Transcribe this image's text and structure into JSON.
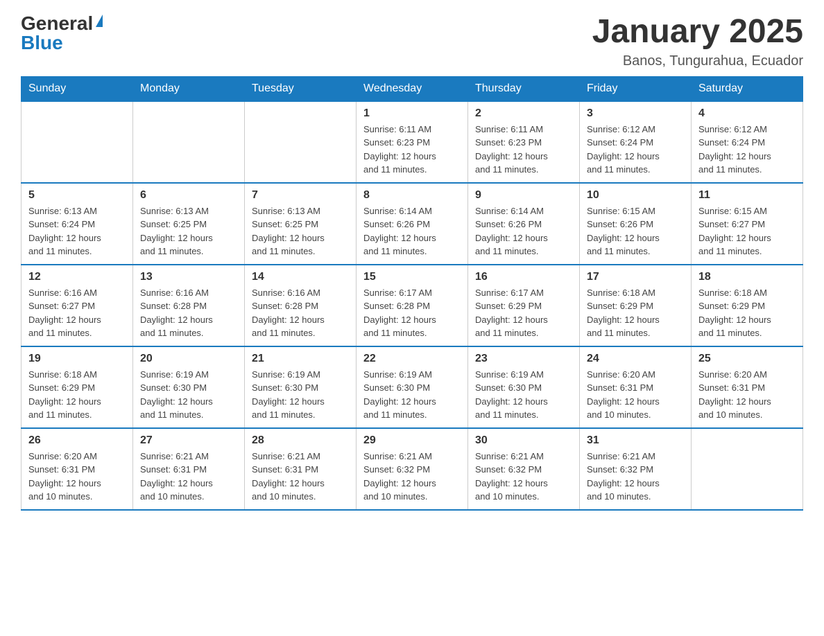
{
  "header": {
    "logo_general": "General",
    "logo_blue": "Blue",
    "month_title": "January 2025",
    "location": "Banos, Tungurahua, Ecuador"
  },
  "days_of_week": [
    "Sunday",
    "Monday",
    "Tuesday",
    "Wednesday",
    "Thursday",
    "Friday",
    "Saturday"
  ],
  "weeks": [
    [
      {
        "day": "",
        "info": ""
      },
      {
        "day": "",
        "info": ""
      },
      {
        "day": "",
        "info": ""
      },
      {
        "day": "1",
        "info": "Sunrise: 6:11 AM\nSunset: 6:23 PM\nDaylight: 12 hours\nand 11 minutes."
      },
      {
        "day": "2",
        "info": "Sunrise: 6:11 AM\nSunset: 6:23 PM\nDaylight: 12 hours\nand 11 minutes."
      },
      {
        "day": "3",
        "info": "Sunrise: 6:12 AM\nSunset: 6:24 PM\nDaylight: 12 hours\nand 11 minutes."
      },
      {
        "day": "4",
        "info": "Sunrise: 6:12 AM\nSunset: 6:24 PM\nDaylight: 12 hours\nand 11 minutes."
      }
    ],
    [
      {
        "day": "5",
        "info": "Sunrise: 6:13 AM\nSunset: 6:24 PM\nDaylight: 12 hours\nand 11 minutes."
      },
      {
        "day": "6",
        "info": "Sunrise: 6:13 AM\nSunset: 6:25 PM\nDaylight: 12 hours\nand 11 minutes."
      },
      {
        "day": "7",
        "info": "Sunrise: 6:13 AM\nSunset: 6:25 PM\nDaylight: 12 hours\nand 11 minutes."
      },
      {
        "day": "8",
        "info": "Sunrise: 6:14 AM\nSunset: 6:26 PM\nDaylight: 12 hours\nand 11 minutes."
      },
      {
        "day": "9",
        "info": "Sunrise: 6:14 AM\nSunset: 6:26 PM\nDaylight: 12 hours\nand 11 minutes."
      },
      {
        "day": "10",
        "info": "Sunrise: 6:15 AM\nSunset: 6:26 PM\nDaylight: 12 hours\nand 11 minutes."
      },
      {
        "day": "11",
        "info": "Sunrise: 6:15 AM\nSunset: 6:27 PM\nDaylight: 12 hours\nand 11 minutes."
      }
    ],
    [
      {
        "day": "12",
        "info": "Sunrise: 6:16 AM\nSunset: 6:27 PM\nDaylight: 12 hours\nand 11 minutes."
      },
      {
        "day": "13",
        "info": "Sunrise: 6:16 AM\nSunset: 6:28 PM\nDaylight: 12 hours\nand 11 minutes."
      },
      {
        "day": "14",
        "info": "Sunrise: 6:16 AM\nSunset: 6:28 PM\nDaylight: 12 hours\nand 11 minutes."
      },
      {
        "day": "15",
        "info": "Sunrise: 6:17 AM\nSunset: 6:28 PM\nDaylight: 12 hours\nand 11 minutes."
      },
      {
        "day": "16",
        "info": "Sunrise: 6:17 AM\nSunset: 6:29 PM\nDaylight: 12 hours\nand 11 minutes."
      },
      {
        "day": "17",
        "info": "Sunrise: 6:18 AM\nSunset: 6:29 PM\nDaylight: 12 hours\nand 11 minutes."
      },
      {
        "day": "18",
        "info": "Sunrise: 6:18 AM\nSunset: 6:29 PM\nDaylight: 12 hours\nand 11 minutes."
      }
    ],
    [
      {
        "day": "19",
        "info": "Sunrise: 6:18 AM\nSunset: 6:29 PM\nDaylight: 12 hours\nand 11 minutes."
      },
      {
        "day": "20",
        "info": "Sunrise: 6:19 AM\nSunset: 6:30 PM\nDaylight: 12 hours\nand 11 minutes."
      },
      {
        "day": "21",
        "info": "Sunrise: 6:19 AM\nSunset: 6:30 PM\nDaylight: 12 hours\nand 11 minutes."
      },
      {
        "day": "22",
        "info": "Sunrise: 6:19 AM\nSunset: 6:30 PM\nDaylight: 12 hours\nand 11 minutes."
      },
      {
        "day": "23",
        "info": "Sunrise: 6:19 AM\nSunset: 6:30 PM\nDaylight: 12 hours\nand 11 minutes."
      },
      {
        "day": "24",
        "info": "Sunrise: 6:20 AM\nSunset: 6:31 PM\nDaylight: 12 hours\nand 10 minutes."
      },
      {
        "day": "25",
        "info": "Sunrise: 6:20 AM\nSunset: 6:31 PM\nDaylight: 12 hours\nand 10 minutes."
      }
    ],
    [
      {
        "day": "26",
        "info": "Sunrise: 6:20 AM\nSunset: 6:31 PM\nDaylight: 12 hours\nand 10 minutes."
      },
      {
        "day": "27",
        "info": "Sunrise: 6:21 AM\nSunset: 6:31 PM\nDaylight: 12 hours\nand 10 minutes."
      },
      {
        "day": "28",
        "info": "Sunrise: 6:21 AM\nSunset: 6:31 PM\nDaylight: 12 hours\nand 10 minutes."
      },
      {
        "day": "29",
        "info": "Sunrise: 6:21 AM\nSunset: 6:32 PM\nDaylight: 12 hours\nand 10 minutes."
      },
      {
        "day": "30",
        "info": "Sunrise: 6:21 AM\nSunset: 6:32 PM\nDaylight: 12 hours\nand 10 minutes."
      },
      {
        "day": "31",
        "info": "Sunrise: 6:21 AM\nSunset: 6:32 PM\nDaylight: 12 hours\nand 10 minutes."
      },
      {
        "day": "",
        "info": ""
      }
    ]
  ]
}
